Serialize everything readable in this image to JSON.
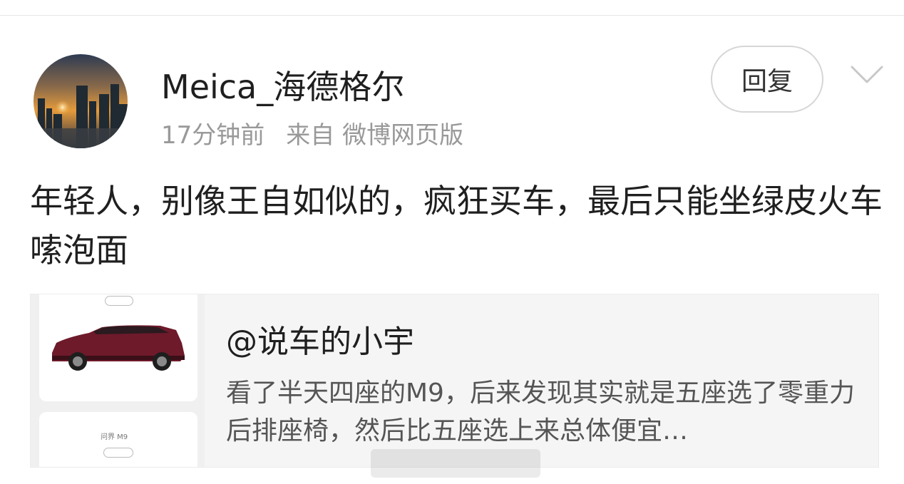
{
  "post": {
    "author": "Meica_海德格尔",
    "time": "17分钟前",
    "source": "来自 微博网页版",
    "reply_label": "回复",
    "text": "年轻人，别像王自如似的，疯狂买车，最后只能坐绿皮火车嗦泡面"
  },
  "card": {
    "author": "@说车的小宇",
    "excerpt": "看了半天四座的M9，后来发现其实就是五座选了零重力后排座椅，然后比五座选上来总体便宜…",
    "thumb_label": "问界 M9"
  },
  "icons": {
    "avatar": "city-sunset-avatar",
    "more": "chevron-down-icon"
  },
  "colors": {
    "meta_gray": "#999999",
    "card_bg": "#f5f5f5",
    "car_red": "#6e1a2b"
  }
}
